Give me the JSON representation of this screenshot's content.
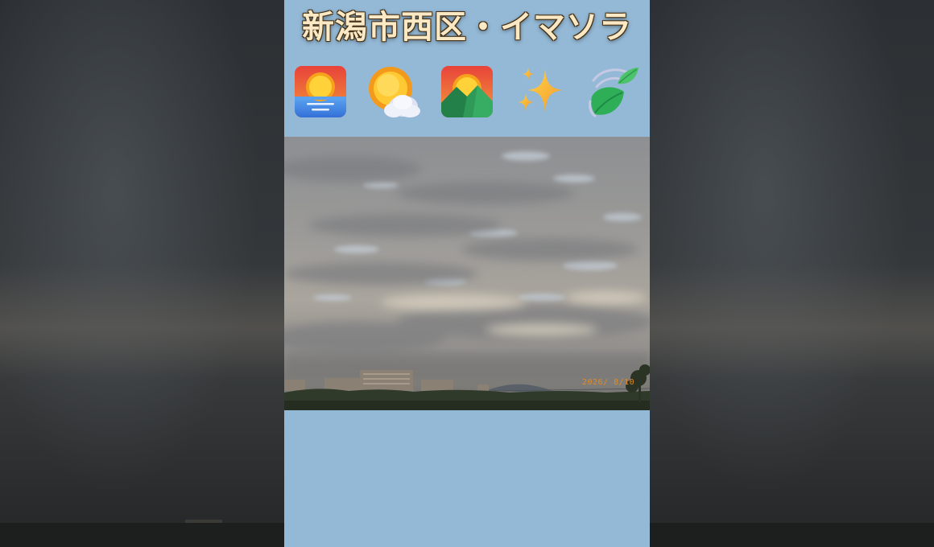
{
  "title": "新潟市西区・イマソラ",
  "icons": [
    {
      "name": "sunrise-over-water-icon"
    },
    {
      "name": "sun-behind-cloud-icon"
    },
    {
      "name": "sunrise-over-mountains-icon"
    },
    {
      "name": "sparkles-icon"
    },
    {
      "name": "leaves-fluttering-icon"
    }
  ],
  "photo": {
    "date_stamp": "2026/ 8/10"
  },
  "colors": {
    "panel_background": "#94b9d6",
    "title_text": "#fbe8c5",
    "date_stamp": "#e0892a"
  }
}
